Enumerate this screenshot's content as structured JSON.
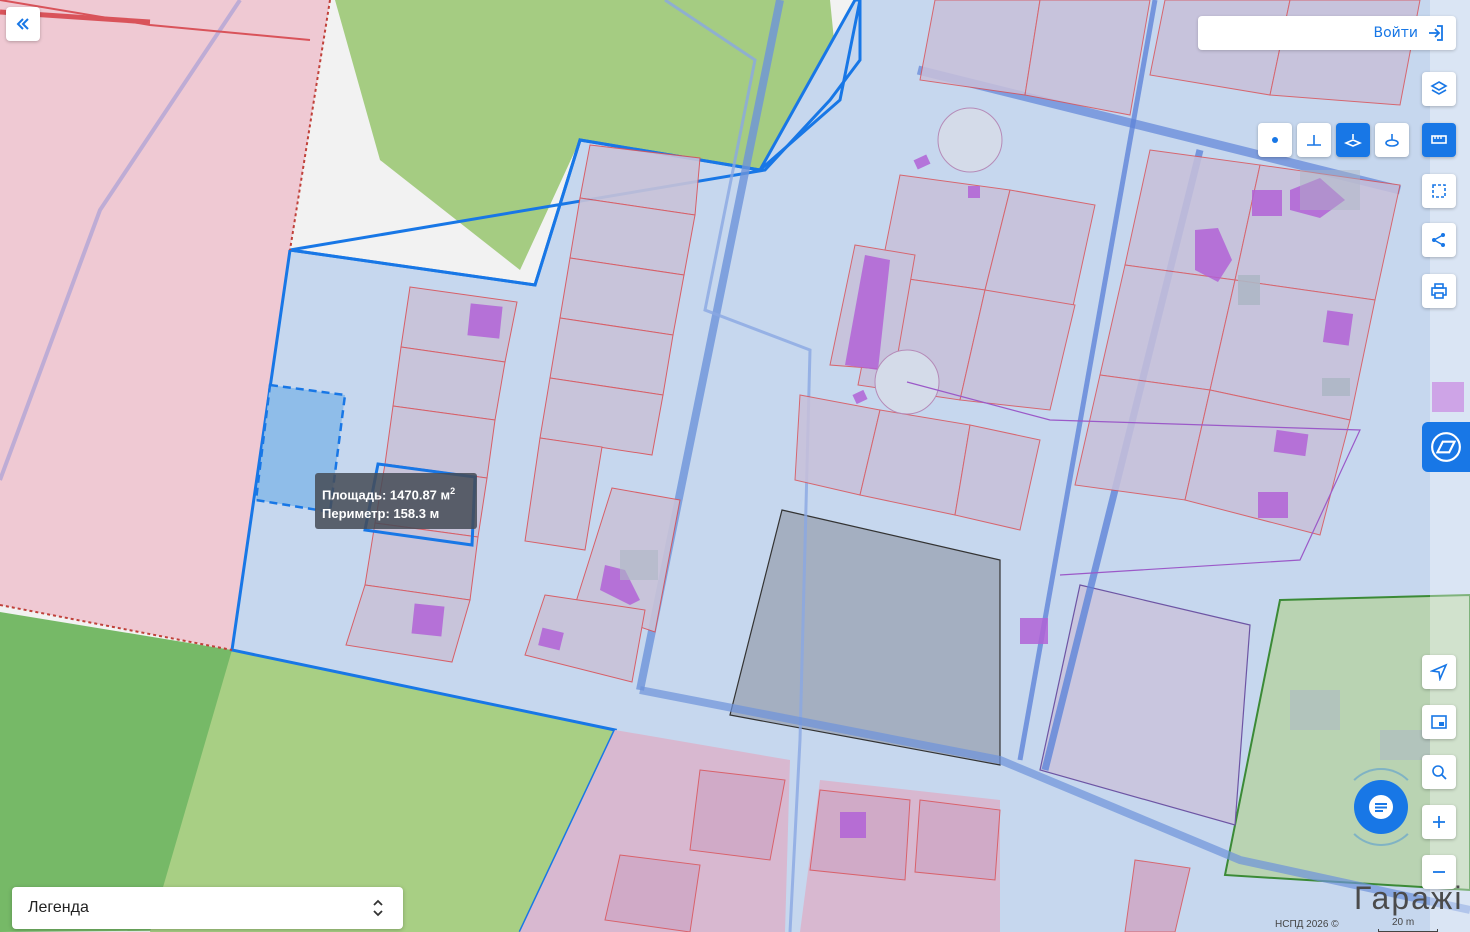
{
  "header": {
    "login_label": "Войти"
  },
  "tooltip": {
    "area_label": "Площадь: 1470.87 м",
    "area_sup": "2",
    "perimeter_label": "Периметр: 158.3 м"
  },
  "legend": {
    "label": "Легенда"
  },
  "map": {
    "street_label": "Гаражі",
    "attribution": "НСПД 2026 ©",
    "scale_label": "20 m"
  },
  "colors": {
    "accent": "#1877e6",
    "parcel_outline": "#d9535a",
    "building": "#b163d6",
    "green_zone": "#8cc265",
    "pink_zone": "#efc9d2",
    "blue_zone": "#bcd3ee"
  },
  "icons": {
    "collapse": "double-chevron-left-icon",
    "login": "sign-in-icon",
    "layers": "layers-icon",
    "point": "point-icon",
    "line": "line-measure-icon",
    "area": "area-measure-icon",
    "circle": "circle-measure-icon",
    "ruler": "ruler-icon",
    "select": "select-area-icon",
    "share": "share-icon",
    "print": "print-icon",
    "locate": "locate-icon",
    "pip": "picture-in-picture-icon",
    "search_point": "search-location-icon",
    "zoom_in": "plus-icon",
    "zoom_out": "minus-icon",
    "chat": "chat-icon",
    "nspd": "nspd-logo-icon"
  }
}
